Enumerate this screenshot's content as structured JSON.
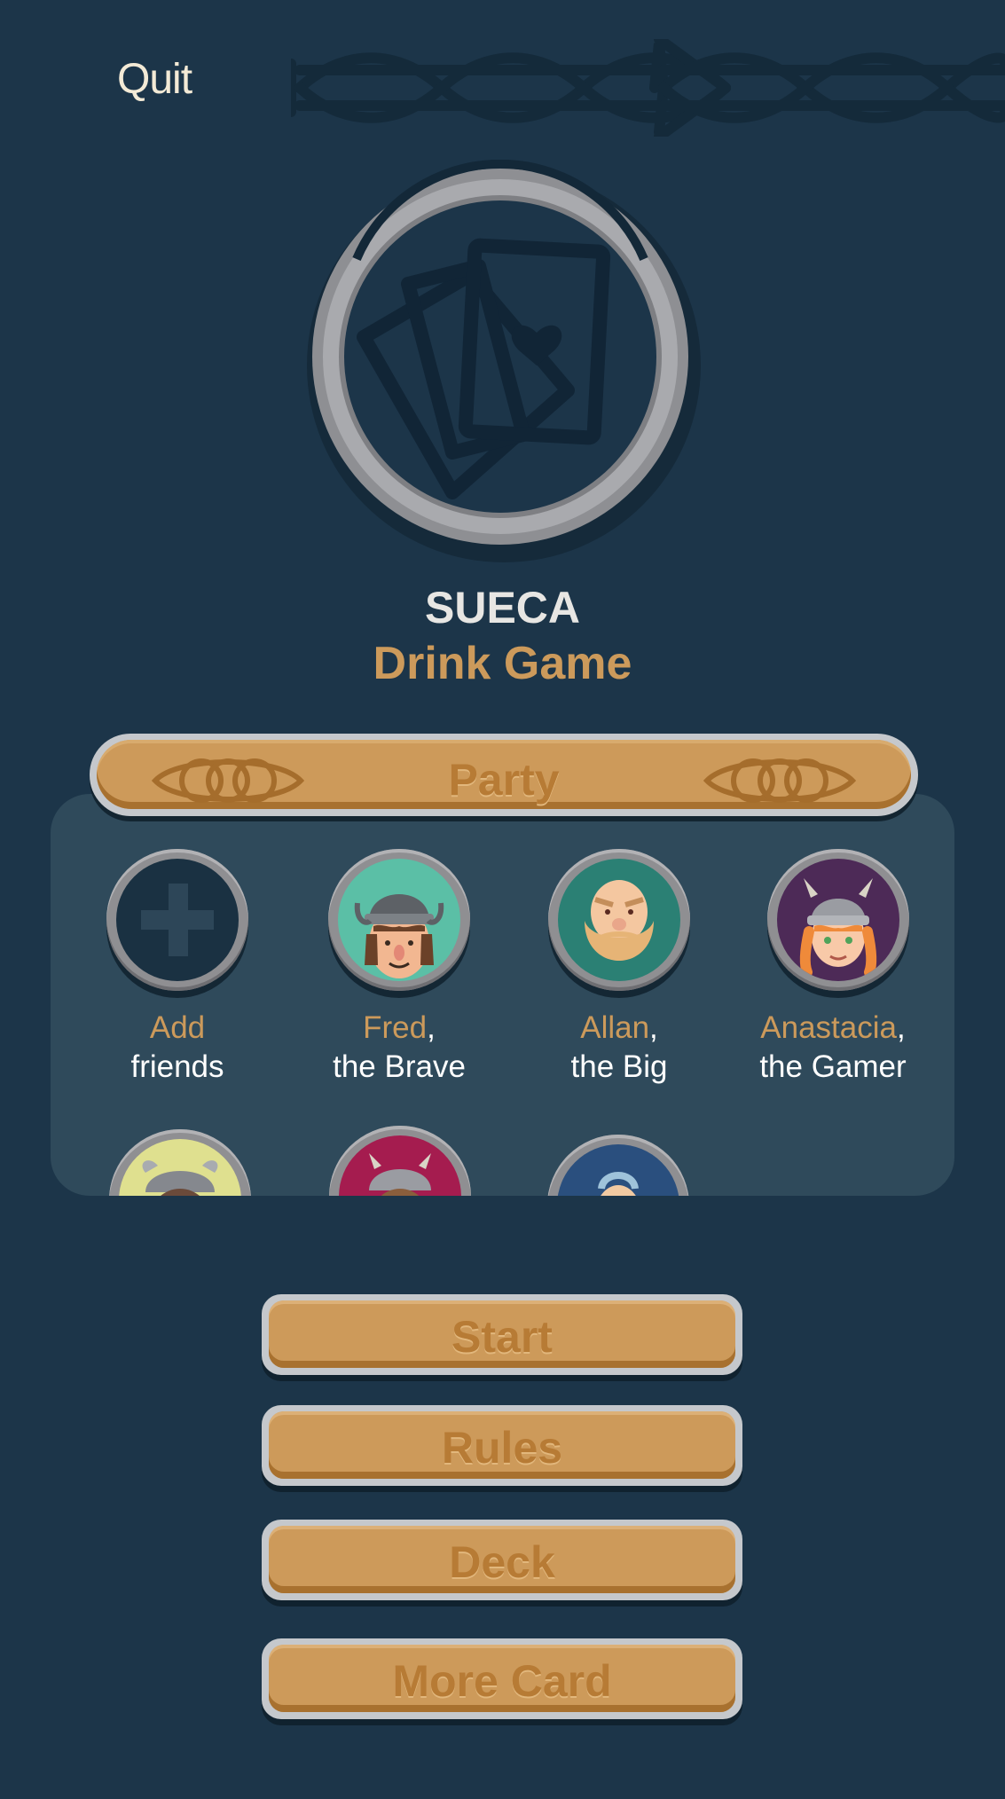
{
  "header": {
    "quit_label": "Quit"
  },
  "logo": {
    "icon": "playing-cards-icon"
  },
  "titles": {
    "line1": "SUECA",
    "line2": "Drink Game"
  },
  "party": {
    "label": "Party",
    "members": [
      {
        "name": "Add",
        "comma": "",
        "title": "friends",
        "icon": "add-plus-icon"
      },
      {
        "name": "Fred",
        "comma": ",",
        "title": "the Brave",
        "icon": "viking-boy-avatar"
      },
      {
        "name": "Allan",
        "comma": ",",
        "title": "the Big",
        "icon": "bearded-viking-avatar"
      },
      {
        "name": "Anastacia",
        "comma": ",",
        "title": "the Gamer",
        "icon": "viking-girl-avatar"
      }
    ]
  },
  "menu": {
    "start": "Start",
    "rules": "Rules",
    "deck": "Deck",
    "more": "More Card"
  },
  "colors": {
    "background": "#1c3549",
    "gold": "#cd9a5a",
    "gold_text": "#b77b35",
    "name_accent": "#cc9a5b"
  }
}
